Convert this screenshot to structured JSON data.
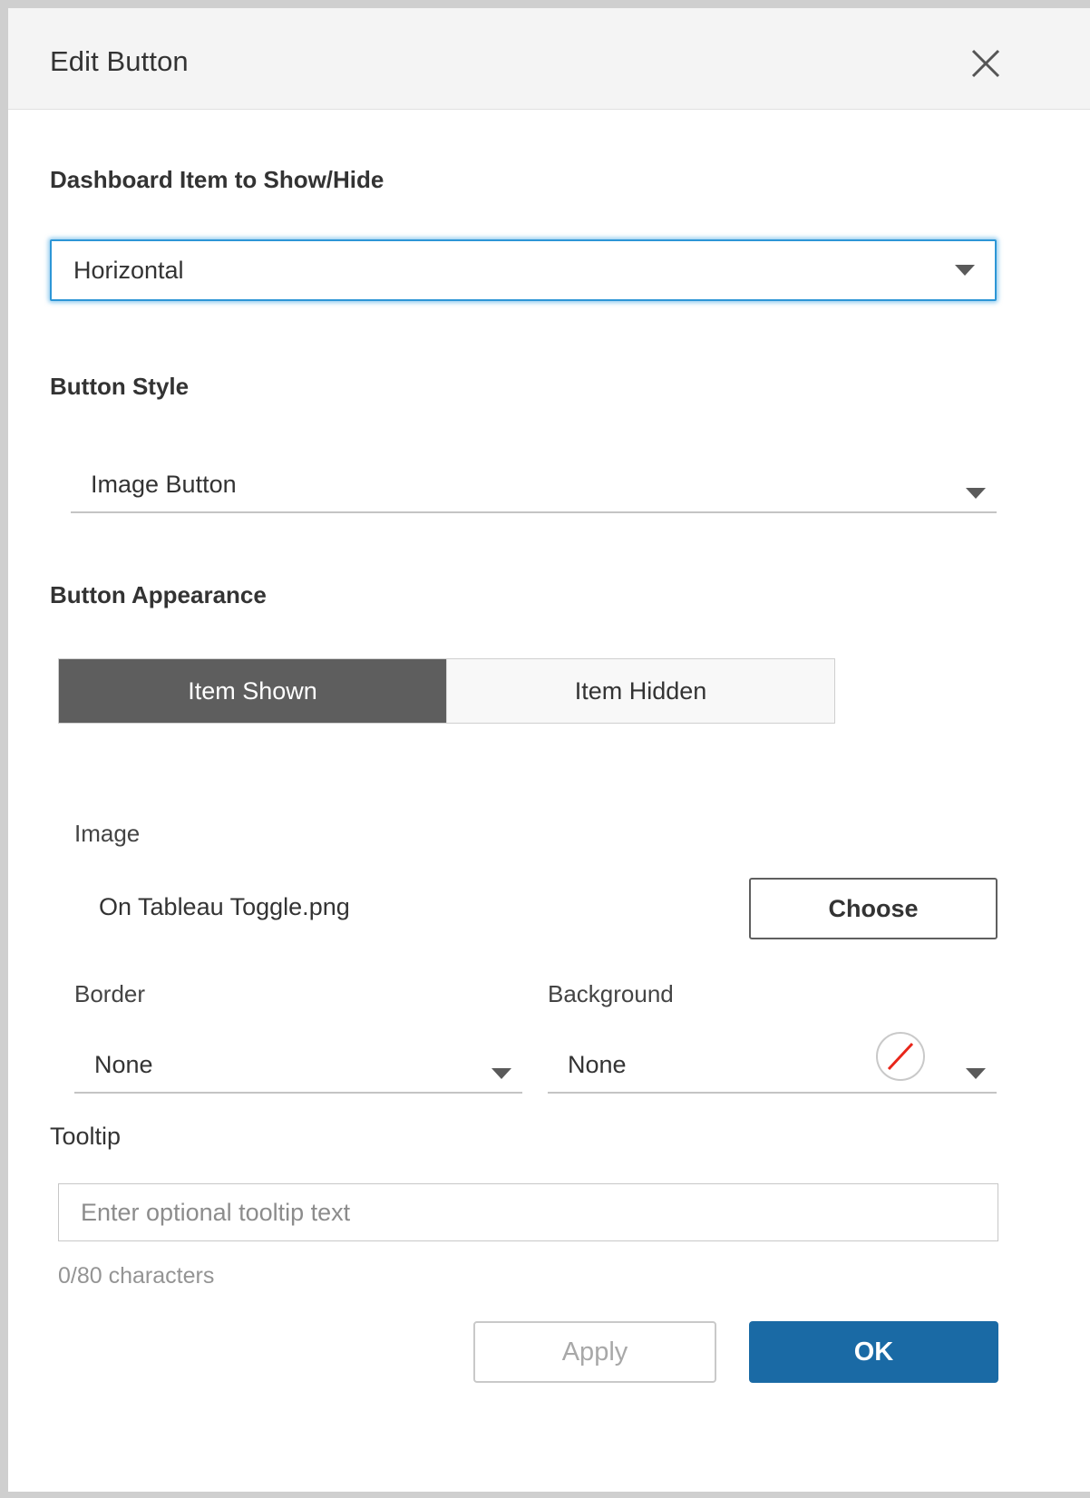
{
  "dialog": {
    "title": "Edit Button",
    "close_icon": "close-icon"
  },
  "sections": {
    "item_to_show_hide": {
      "heading": "Dashboard Item to Show/Hide",
      "selected": "Horizontal"
    },
    "button_style": {
      "heading": "Button Style",
      "selected": "Image Button"
    },
    "button_appearance": {
      "heading": "Button Appearance",
      "tabs": [
        {
          "label": "Item Shown",
          "active": true
        },
        {
          "label": "Item Hidden",
          "active": false
        }
      ]
    }
  },
  "image": {
    "label": "Image",
    "file_name": "On Tableau Toggle.png",
    "choose_label": "Choose"
  },
  "border": {
    "label": "Border",
    "selected": "None"
  },
  "background": {
    "label": "Background",
    "selected": "None",
    "swatch_icon": "no-color-icon"
  },
  "tooltip": {
    "label": "Tooltip",
    "value": "",
    "placeholder": "Enter optional tooltip text",
    "char_count": "0/80 characters"
  },
  "footer": {
    "apply_label": "Apply",
    "ok_label": "OK"
  },
  "colors": {
    "accent_blue": "#1a6aa5",
    "focus_blue": "#2d96d6",
    "active_tab": "#5e5e5e",
    "header_bg": "#f4f4f4",
    "no_color_red": "#e8261a"
  }
}
